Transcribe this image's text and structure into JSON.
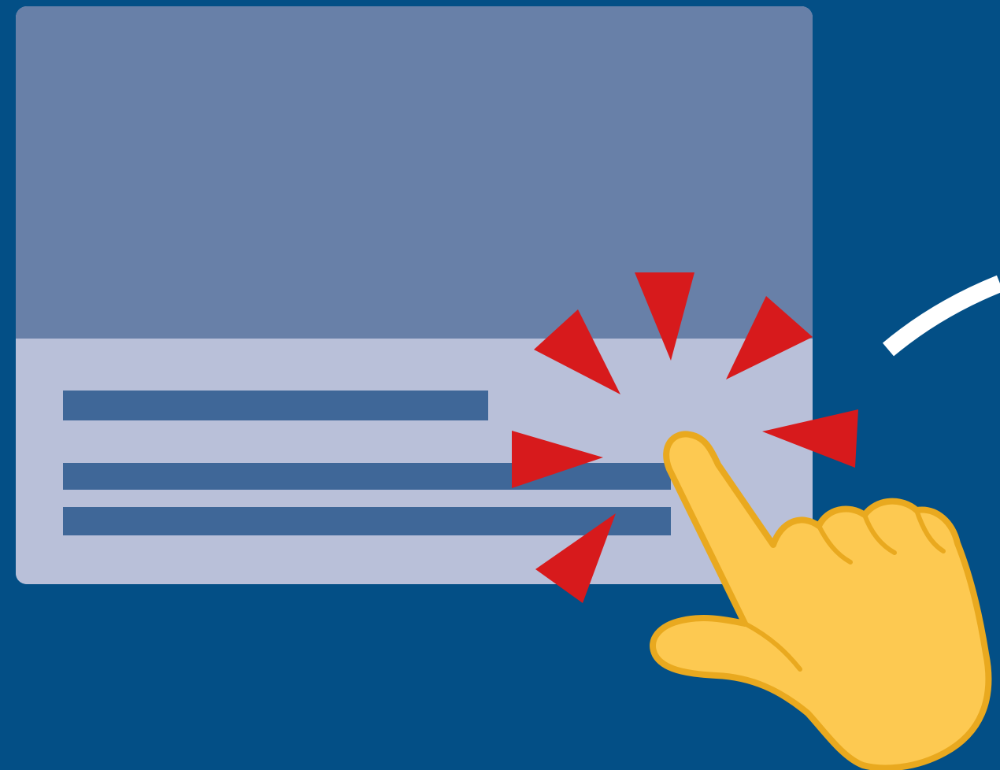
{
  "colors": {
    "background": "#034f86",
    "card_image": "#6880a8",
    "card_body": "#b9c0d9",
    "text_placeholder": "#3f6798",
    "click_burst": "#d71a1c",
    "hand_fill": "#fdc951",
    "hand_outline": "#e9a91f",
    "swipe_arc": "#ffffff"
  },
  "icons": {
    "hand": "pointing-hand-icon",
    "burst": "click-burst-icon",
    "arc": "swipe-arc-icon"
  },
  "card": {
    "image_placeholder": "image-placeholder",
    "text_placeholder_lines": 3
  }
}
